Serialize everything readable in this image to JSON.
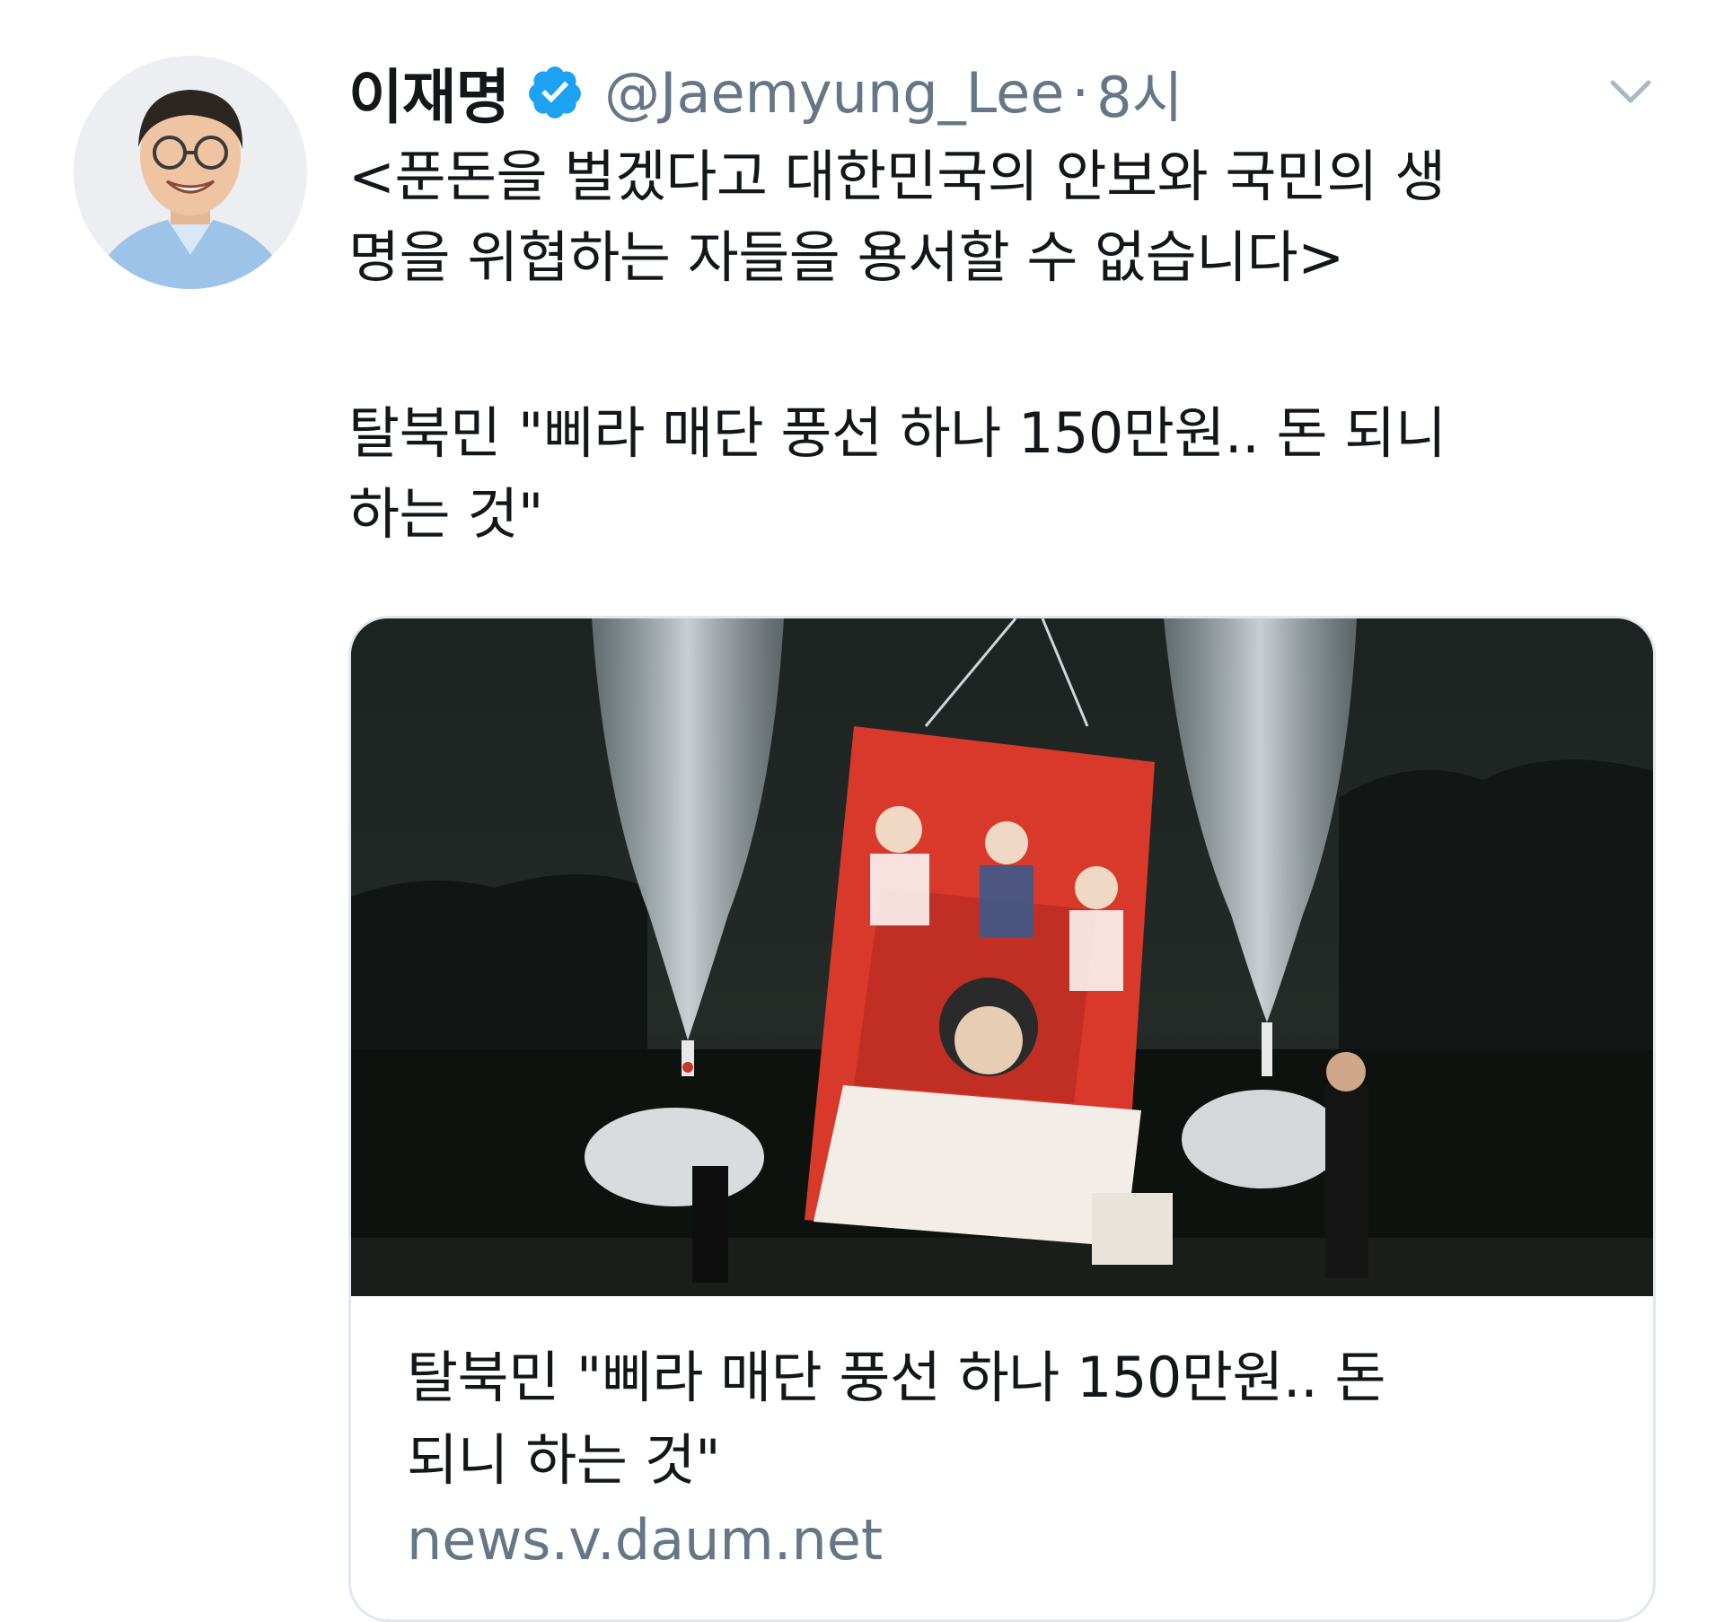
{
  "tweet": {
    "author": {
      "display_name": "이재명",
      "verified": true,
      "handle": "@Jaemyung_Lee",
      "separator": "·",
      "time": "8시",
      "avatar_icon": "avatar-photo"
    },
    "menu_icon": "chevron-down-icon",
    "text_lines": [
      "<푼돈을 벌겠다고 대한민국의 안보와 국민의 생",
      "명을 위협하는 자들을 용서할 수 없습니다>"
    ],
    "headline_lines": [
      "탈북민 \"삐라 매단 풍선 하나 150만원.. 돈 되니",
      "하는 것\""
    ],
    "card": {
      "image_icon": "balloon-launch-photo",
      "title_lines": [
        "탈북민 \"삐라 매단 풍선 하나 150만원.. 돈",
        "되니 하는 것\""
      ],
      "domain": "news.v.daum.net"
    }
  },
  "colors": {
    "text": "#14171a",
    "secondary": "#657786",
    "verified_badge": "#1da1f2",
    "card_border": "#e1e8ed",
    "banner_red": "#d8392b"
  }
}
